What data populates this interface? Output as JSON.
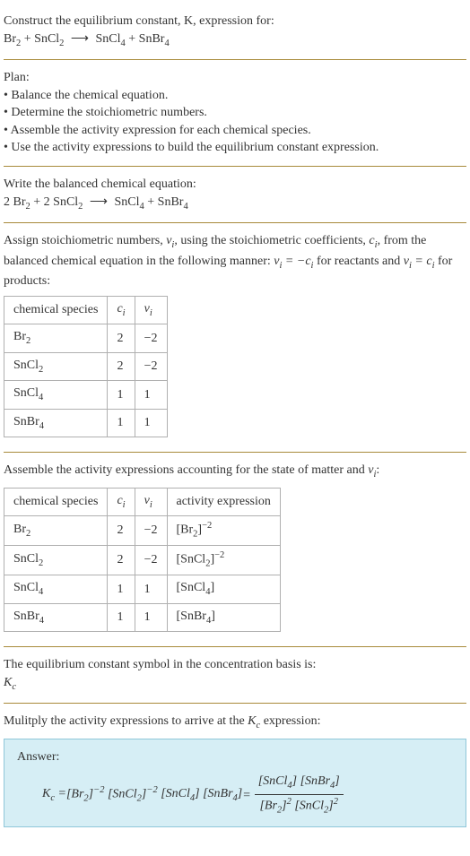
{
  "chart_data": [
    {
      "type": "table",
      "title": "Stoichiometric numbers",
      "columns": [
        "chemical species",
        "c_i",
        "ν_i"
      ],
      "rows": [
        [
          "Br2",
          2,
          -2
        ],
        [
          "SnCl2",
          2,
          -2
        ],
        [
          "SnCl4",
          1,
          1
        ],
        [
          "SnBr4",
          1,
          1
        ]
      ]
    },
    {
      "type": "table",
      "title": "Activity expressions",
      "columns": [
        "chemical species",
        "c_i",
        "ν_i",
        "activity expression"
      ],
      "rows": [
        [
          "Br2",
          2,
          -2,
          "[Br2]^-2"
        ],
        [
          "SnCl2",
          2,
          -2,
          "[SnCl2]^-2"
        ],
        [
          "SnCl4",
          1,
          1,
          "[SnCl4]"
        ],
        [
          "SnBr4",
          1,
          1,
          "[SnBr4]"
        ]
      ]
    }
  ],
  "header": {
    "line1": "Construct the equilibrium constant, K, expression for:",
    "reaction_lhs1": "Br",
    "reaction_lhs1_sub": "2",
    "plus": " + ",
    "reaction_lhs2": "SnCl",
    "reaction_lhs2_sub": "2",
    "arrow": "⟶",
    "reaction_rhs1": "SnCl",
    "reaction_rhs1_sub": "4",
    "reaction_rhs2": "SnBr",
    "reaction_rhs2_sub": "4"
  },
  "plan": {
    "title": "Plan:",
    "b1": "Balance the chemical equation.",
    "b2": "Determine the stoichiometric numbers.",
    "b3": "Assemble the activity expression for each chemical species.",
    "b4": "Use the activity expressions to build the equilibrium constant expression."
  },
  "balanced": {
    "title": "Write the balanced chemical equation:",
    "c1": "2 ",
    "sp1": "Br",
    "sp1s": "2",
    "c2": "2 ",
    "sp2": "SnCl",
    "sp2s": "2",
    "sp3": "SnCl",
    "sp3s": "4",
    "sp4": "SnBr",
    "sp4s": "4"
  },
  "assign": {
    "text1": "Assign stoichiometric numbers, ",
    "nu_i": "ν",
    "nu_is": "i",
    "text2": ", using the stoichiometric coefficients, ",
    "c_i": "c",
    "c_is": "i",
    "text3": ", from the balanced chemical equation in the following manner: ",
    "rel1a": "ν",
    "rel1as": "i",
    "rel1eq": " = −",
    "rel1b": "c",
    "rel1bs": "i",
    "text4": " for reactants and ",
    "rel2a": "ν",
    "rel2as": "i",
    "rel2eq": " = ",
    "rel2b": "c",
    "rel2bs": "i",
    "text5": " for products:"
  },
  "t1": {
    "h1": "chemical species",
    "h2": "c",
    "h2s": "i",
    "h3": "ν",
    "h3s": "i",
    "r1c1": "Br",
    "r1c1s": "2",
    "r1c2": "2",
    "r1c3": "−2",
    "r2c1": "SnCl",
    "r2c1s": "2",
    "r2c2": "2",
    "r2c3": "−2",
    "r3c1": "SnCl",
    "r3c1s": "4",
    "r3c2": "1",
    "r3c3": "1",
    "r4c1": "SnBr",
    "r4c1s": "4",
    "r4c2": "1",
    "r4c3": "1"
  },
  "assemble": {
    "text1": "Assemble the activity expressions accounting for the state of matter and ",
    "nu": "ν",
    "nus": "i",
    "text2": ":"
  },
  "t2": {
    "h1": "chemical species",
    "h2": "c",
    "h2s": "i",
    "h3": "ν",
    "h3s": "i",
    "h4": "activity expression",
    "r1c1": "Br",
    "r1c1s": "2",
    "r1c2": "2",
    "r1c3": "−2",
    "r1c4a": "[Br",
    "r1c4as": "2",
    "r1c4b": "]",
    "r1c4e": "−2",
    "r2c1": "SnCl",
    "r2c1s": "2",
    "r2c2": "2",
    "r2c3": "−2",
    "r2c4a": "[SnCl",
    "r2c4as": "2",
    "r2c4b": "]",
    "r2c4e": "−2",
    "r3c1": "SnCl",
    "r3c1s": "4",
    "r3c2": "1",
    "r3c3": "1",
    "r3c4a": "[SnCl",
    "r3c4as": "4",
    "r3c4b": "]",
    "r4c1": "SnBr",
    "r4c1s": "4",
    "r4c2": "1",
    "r4c3": "1",
    "r4c4a": "[SnBr",
    "r4c4as": "4",
    "r4c4b": "]"
  },
  "eqsym": {
    "line1": "The equilibrium constant symbol in the concentration basis is:",
    "K": "K",
    "Ks": "c"
  },
  "mult": {
    "text1": "Mulitply the activity expressions to arrive at the ",
    "K": "K",
    "Ks": "c",
    "text2": " expression:"
  },
  "answer": {
    "label": "Answer:",
    "K": "K",
    "Ks": "c",
    "eq": " = ",
    "p1a": "[Br",
    "p1as": "2",
    "p1b": "]",
    "p1e": "−2",
    "p2a": "[SnCl",
    "p2as": "2",
    "p2b": "]",
    "p2e": "−2",
    "p3a": "[SnCl",
    "p3as": "4",
    "p3b": "]",
    "p4a": "[SnBr",
    "p4as": "4",
    "p4b": "]",
    "eq2": " = ",
    "numA": "[SnCl",
    "numAs": "4",
    "numAb": "] ",
    "numB": "[SnBr",
    "numBs": "4",
    "numBb": "]",
    "denA": "[Br",
    "denAs": "2",
    "denAb": "]",
    "denAe": "2",
    "denB": "[SnCl",
    "denBs": "2",
    "denBb": "]",
    "denBe": "2"
  }
}
